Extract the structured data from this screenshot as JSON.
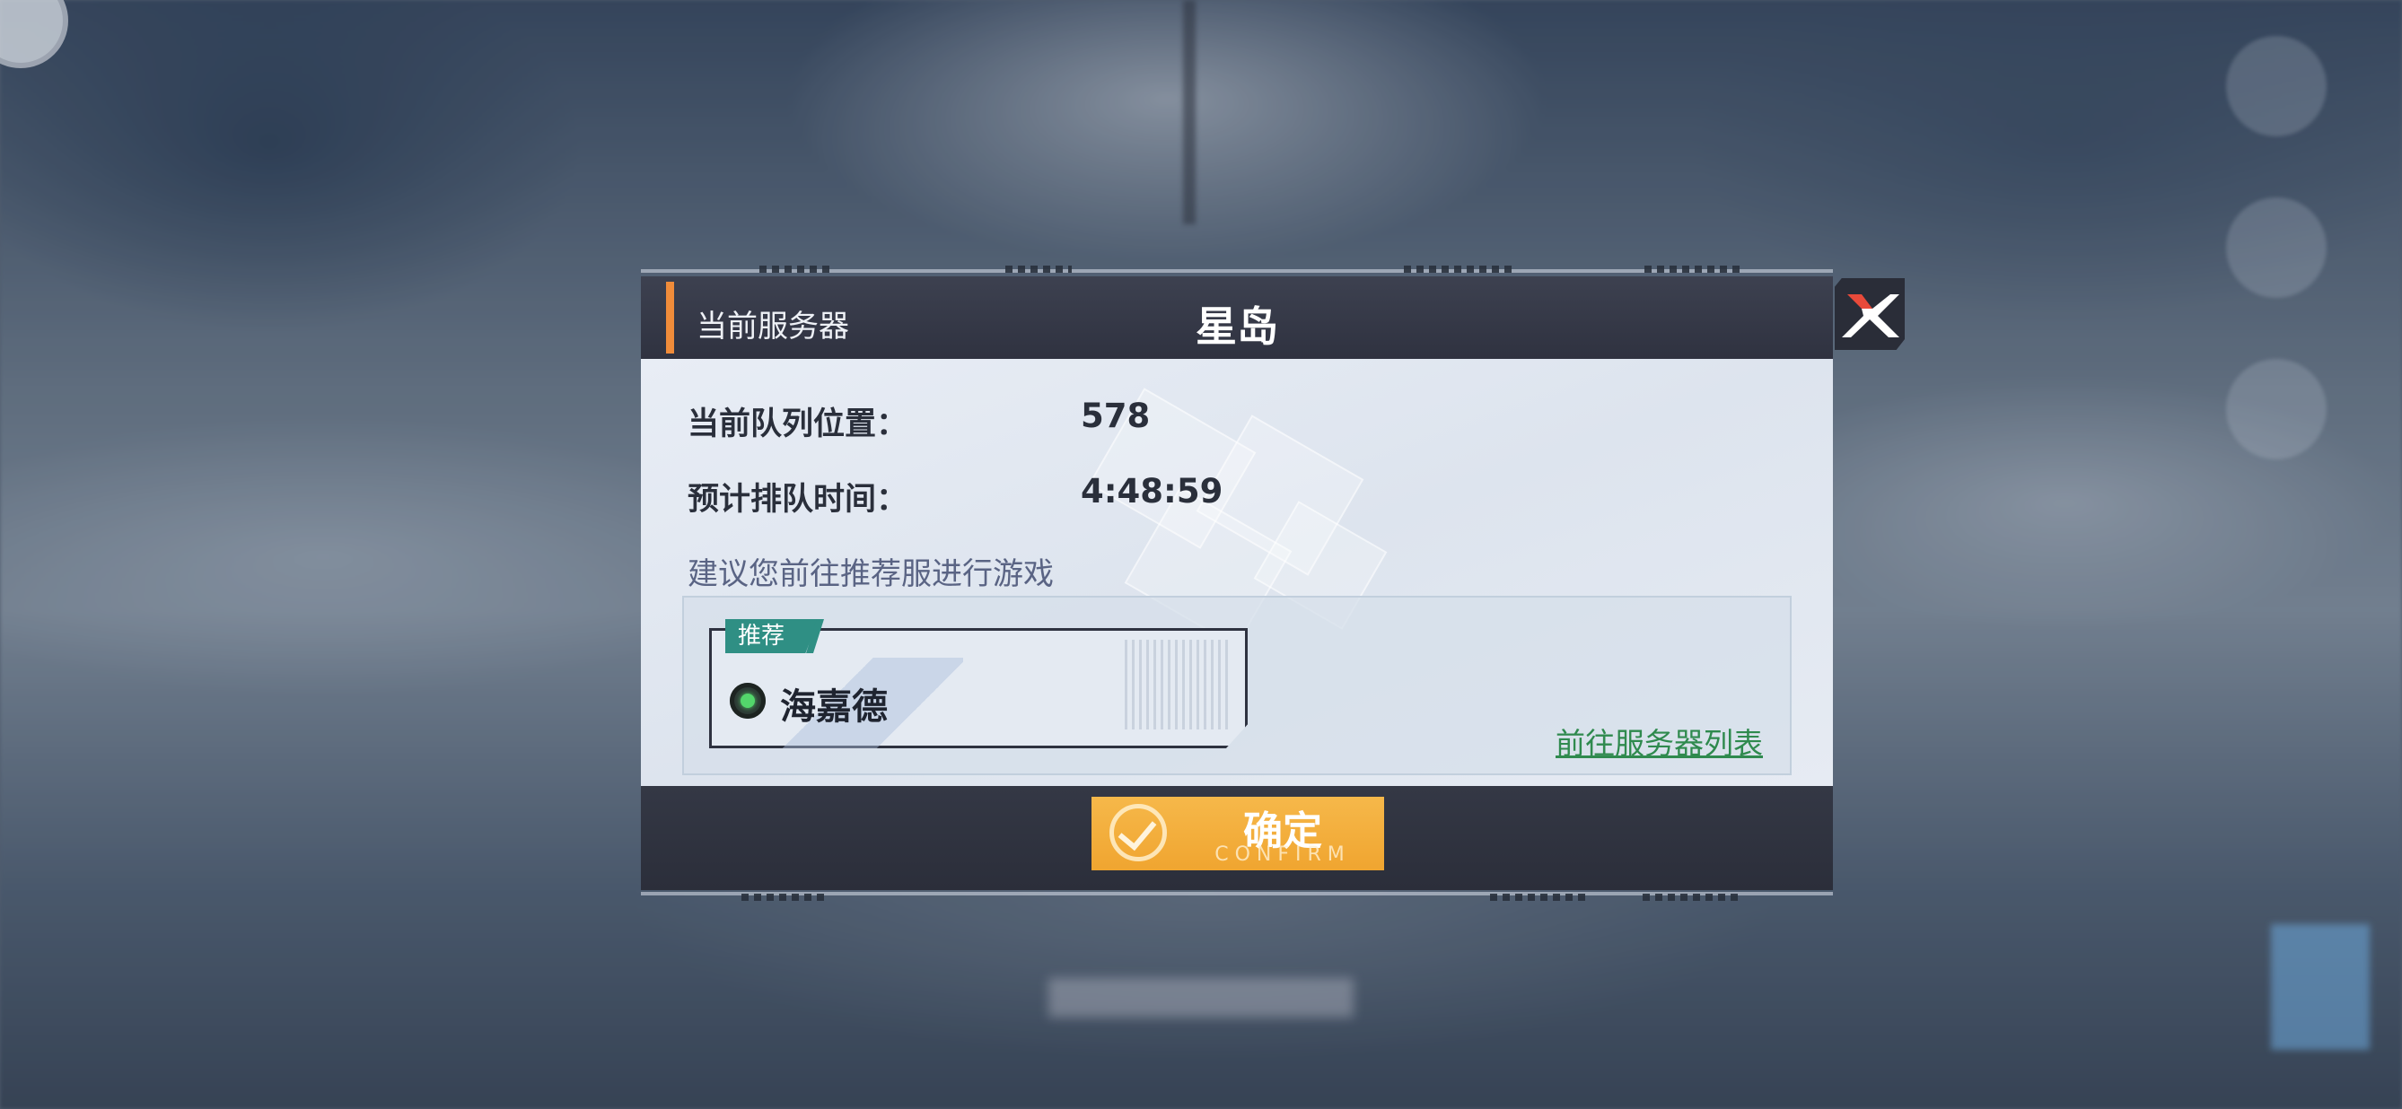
{
  "header": {
    "label": "当前服务器",
    "server_title": "星岛"
  },
  "queue": {
    "position_label": "当前队列位置：",
    "position_value": "578",
    "time_label": "预计排队时间：",
    "time_value": "4:48:59"
  },
  "hint": "建议您前往推荐服进行游戏",
  "recommended": {
    "tag": "推荐",
    "server_name": "海嘉德",
    "status_color": "#53d66b"
  },
  "server_list_link": "前往服务器列表",
  "confirm": {
    "label": "确定",
    "sublabel": "CONFIRM"
  },
  "colors": {
    "accent": "#f08c3a",
    "confirm": "#f0a530",
    "link": "#2f8a4e",
    "tag": "#2f8f84"
  }
}
